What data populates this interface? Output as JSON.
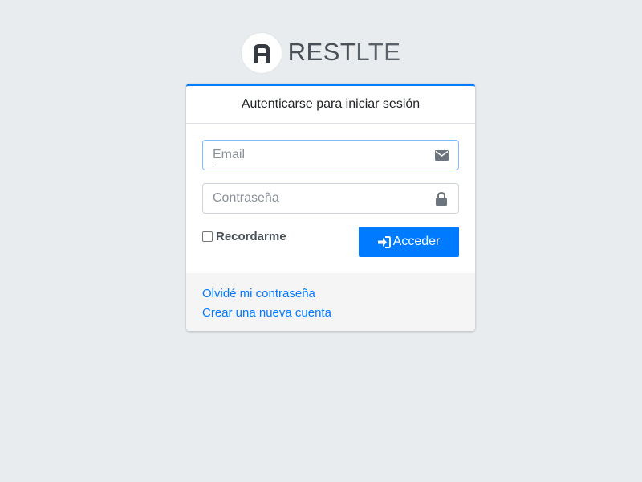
{
  "brand": {
    "name_bold": "REST",
    "name_light": "LTE",
    "logo_icon": "letter-a-logo-icon"
  },
  "card": {
    "header": "Autenticarse para iniciar sesión",
    "accent_color": "#007bff"
  },
  "form": {
    "email": {
      "placeholder": "Email",
      "value": "",
      "icon": "envelope-icon"
    },
    "password": {
      "placeholder": "Contraseña",
      "value": "",
      "icon": "lock-icon"
    },
    "remember_label": "Recordarme",
    "remember_checked": false,
    "submit_label": "Acceder",
    "submit_icon": "sign-in-icon"
  },
  "footer": {
    "forgot_link": "Olvidé mi contraseña",
    "register_link": "Crear una nueva cuenta"
  }
}
